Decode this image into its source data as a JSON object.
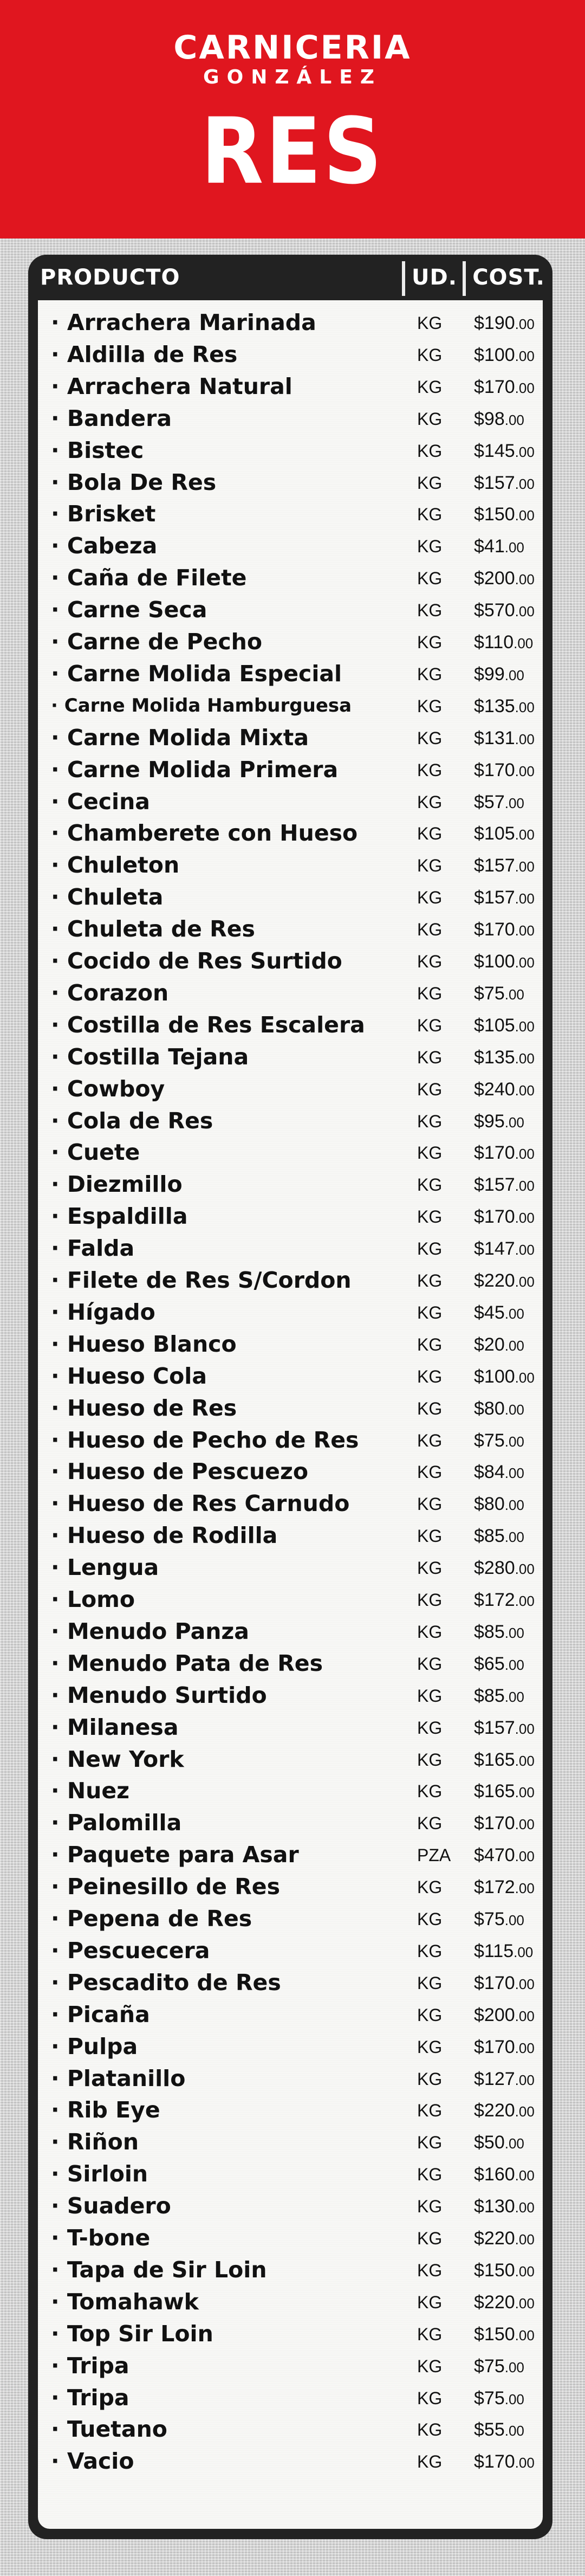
{
  "banner": {
    "brand": "CARNICERIA",
    "brand_sub": "GONZÁLEZ",
    "category": "RES",
    "color": "#e0161f"
  },
  "table": {
    "headers": {
      "product": "PRODUCTO",
      "unit": "UD.",
      "cost": "COST."
    },
    "rows": [
      {
        "name": "· Arrachera Marinada",
        "unit": "KG",
        "price": "$190",
        "cents": ".00"
      },
      {
        "name": "· Aldilla de Res",
        "unit": "KG",
        "price": "$100",
        "cents": ".00"
      },
      {
        "name": "· Arrachera Natural",
        "unit": "KG",
        "price": "$170",
        "cents": ".00"
      },
      {
        "name": "· Bandera",
        "unit": "KG",
        "price": "$98",
        "cents": ".00"
      },
      {
        "name": "· Bistec",
        "unit": "KG",
        "price": "$145",
        "cents": ".00"
      },
      {
        "name": "· Bola De Res",
        "unit": "KG",
        "price": "$157",
        "cents": ".00"
      },
      {
        "name": "· Brisket",
        "unit": "KG",
        "price": "$150",
        "cents": ".00"
      },
      {
        "name": "· Cabeza",
        "unit": "KG",
        "price": "$41",
        "cents": ".00"
      },
      {
        "name": "· Caña de Filete",
        "unit": "KG",
        "price": "$200",
        "cents": ".00"
      },
      {
        "name": "· Carne Seca",
        "unit": "KG",
        "price": "$570",
        "cents": ".00"
      },
      {
        "name": "· Carne de Pecho",
        "unit": "KG",
        "price": "$110",
        "cents": ".00"
      },
      {
        "name": "· Carne Molida Especial",
        "unit": "KG",
        "price": "$99",
        "cents": ".00"
      },
      {
        "name": "· Carne Molida Hamburguesa",
        "unit": "KG",
        "price": "$135",
        "cents": ".00",
        "small": true
      },
      {
        "name": "· Carne Molida Mixta",
        "unit": "KG",
        "price": "$131",
        "cents": ".00"
      },
      {
        "name": "· Carne Molida Primera",
        "unit": "KG",
        "price": "$170",
        "cents": ".00"
      },
      {
        "name": "· Cecina",
        "unit": "KG",
        "price": "$57",
        "cents": ".00"
      },
      {
        "name": "· Chamberete con Hueso",
        "unit": "KG",
        "price": "$105",
        "cents": ".00"
      },
      {
        "name": "· Chuleton",
        "unit": "KG",
        "price": "$157",
        "cents": ".00"
      },
      {
        "name": "· Chuleta",
        "unit": "KG",
        "price": "$157",
        "cents": ".00"
      },
      {
        "name": "· Chuleta de Res",
        "unit": "KG",
        "price": "$170",
        "cents": ".00"
      },
      {
        "name": "· Cocido de Res Surtido",
        "unit": "KG",
        "price": "$100",
        "cents": ".00"
      },
      {
        "name": "· Corazon",
        "unit": "KG",
        "price": "$75",
        "cents": ".00"
      },
      {
        "name": "· Costilla de Res Escalera",
        "unit": "KG",
        "price": "$105",
        "cents": ".00"
      },
      {
        "name": "· Costilla Tejana",
        "unit": "KG",
        "price": "$135",
        "cents": ".00"
      },
      {
        "name": "· Cowboy",
        "unit": "KG",
        "price": "$240",
        "cents": ".00"
      },
      {
        "name": "· Cola de Res",
        "unit": "KG",
        "price": "$95",
        "cents": ".00"
      },
      {
        "name": "· Cuete",
        "unit": "KG",
        "price": "$170",
        "cents": ".00"
      },
      {
        "name": "· Diezmillo",
        "unit": "KG",
        "price": "$157",
        "cents": ".00"
      },
      {
        "name": "· Espaldilla",
        "unit": "KG",
        "price": "$170",
        "cents": ".00"
      },
      {
        "name": "· Falda",
        "unit": "KG",
        "price": "$147",
        "cents": ".00"
      },
      {
        "name": "· Filete de Res S/Cordon",
        "unit": "KG",
        "price": "$220",
        "cents": ".00"
      },
      {
        "name": "· Hígado",
        "unit": "KG",
        "price": "$45",
        "cents": ".00"
      },
      {
        "name": "· Hueso Blanco",
        "unit": "KG",
        "price": "$20",
        "cents": ".00"
      },
      {
        "name": "· Hueso Cola",
        "unit": "KG",
        "price": "$100",
        "cents": ".00"
      },
      {
        "name": "· Hueso de Res",
        "unit": "KG",
        "price": "$80",
        "cents": ".00"
      },
      {
        "name": "· Hueso de Pecho de Res",
        "unit": "KG",
        "price": "$75",
        "cents": ".00"
      },
      {
        "name": "· Hueso de Pescuezo",
        "unit": "KG",
        "price": "$84",
        "cents": ".00"
      },
      {
        "name": "· Hueso de Res Carnudo",
        "unit": "KG",
        "price": "$80",
        "cents": ".00"
      },
      {
        "name": "· Hueso de Rodilla",
        "unit": "KG",
        "price": "$85",
        "cents": ".00"
      },
      {
        "name": "· Lengua",
        "unit": "KG",
        "price": "$280",
        "cents": ".00"
      },
      {
        "name": "· Lomo",
        "unit": "KG",
        "price": "$172",
        "cents": ".00"
      },
      {
        "name": "· Menudo Panza",
        "unit": "KG",
        "price": "$85",
        "cents": ".00"
      },
      {
        "name": "· Menudo Pata de Res",
        "unit": "KG",
        "price": "$65",
        "cents": ".00"
      },
      {
        "name": "· Menudo Surtido",
        "unit": "KG",
        "price": "$85",
        "cents": ".00"
      },
      {
        "name": "· Milanesa",
        "unit": "KG",
        "price": "$157",
        "cents": ".00"
      },
      {
        "name": "· New York",
        "unit": "KG",
        "price": "$165",
        "cents": ".00"
      },
      {
        "name": "· Nuez",
        "unit": "KG",
        "price": "$165",
        "cents": ".00"
      },
      {
        "name": "· Palomilla",
        "unit": "KG",
        "price": "$170",
        "cents": ".00"
      },
      {
        "name": "· Paquete para Asar",
        "unit": "PZA",
        "price": "$470",
        "cents": ".00"
      },
      {
        "name": "· Peinesillo de Res",
        "unit": "KG",
        "price": "$172",
        "cents": ".00"
      },
      {
        "name": "· Pepena de Res",
        "unit": "KG",
        "price": "$75",
        "cents": ".00"
      },
      {
        "name": "· Pescuecera",
        "unit": "KG",
        "price": "$115",
        "cents": ".00"
      },
      {
        "name": "· Pescadito de Res",
        "unit": "KG",
        "price": "$170",
        "cents": ".00"
      },
      {
        "name": "· Picaña",
        "unit": "KG",
        "price": "$200",
        "cents": ".00"
      },
      {
        "name": "· Pulpa",
        "unit": "KG",
        "price": "$170",
        "cents": ".00"
      },
      {
        "name": "· Platanillo",
        "unit": "KG",
        "price": "$127",
        "cents": ".00"
      },
      {
        "name": "· Rib Eye",
        "unit": "KG",
        "price": "$220",
        "cents": ".00"
      },
      {
        "name": "· Riñon",
        "unit": "KG",
        "price": "$50",
        "cents": ".00"
      },
      {
        "name": "· Sirloin",
        "unit": "KG",
        "price": "$160",
        "cents": ".00"
      },
      {
        "name": "· Suadero",
        "unit": "KG",
        "price": "$130",
        "cents": ".00"
      },
      {
        "name": "· T-bone",
        "unit": "KG",
        "price": "$220",
        "cents": ".00"
      },
      {
        "name": "· Tapa de Sir Loin",
        "unit": "KG",
        "price": "$150",
        "cents": ".00"
      },
      {
        "name": "· Tomahawk",
        "unit": "KG",
        "price": "$220",
        "cents": ".00"
      },
      {
        "name": "· Top Sir Loin",
        "unit": "KG",
        "price": "$150",
        "cents": ".00"
      },
      {
        "name": "· Tripa",
        "unit": "KG",
        "price": "$75",
        "cents": ".00"
      },
      {
        "name": "· Tripa",
        "unit": "KG",
        "price": "$75",
        "cents": ".00"
      },
      {
        "name": "· Tuetano",
        "unit": "KG",
        "price": "$55",
        "cents": ".00"
      },
      {
        "name": "· Vacio",
        "unit": "KG",
        "price": "$170",
        "cents": ".00"
      }
    ]
  }
}
